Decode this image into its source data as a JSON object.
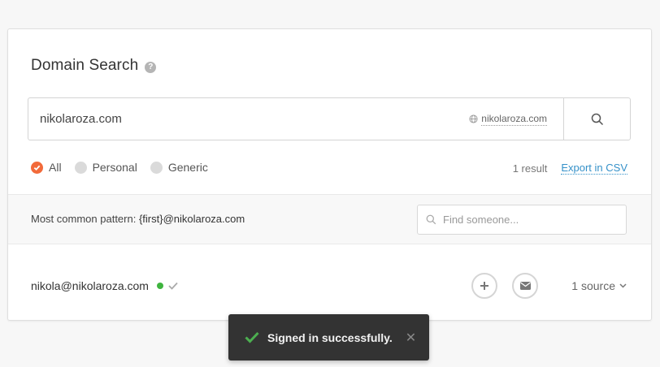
{
  "header": {
    "title": "Domain Search",
    "help_icon": "?"
  },
  "search": {
    "value": "nikolaroza.com",
    "domain_hint": "nikolaroza.com"
  },
  "filters": [
    {
      "label": "All",
      "checked": true
    },
    {
      "label": "Personal",
      "checked": false
    },
    {
      "label": "Generic",
      "checked": false
    }
  ],
  "results": {
    "count_text": "1 result",
    "export_label": "Export in CSV"
  },
  "pattern": {
    "label": "Most common pattern:",
    "value": "{first}@nikolaroza.com"
  },
  "find": {
    "placeholder": "Find someone..."
  },
  "row": {
    "email": "nikola@nikolaroza.com",
    "sources_label": "1 source"
  },
  "toast": {
    "message": "Signed in successfully.",
    "close": "✕"
  },
  "colors": {
    "accent": "#f26a3a",
    "link": "#3591c9",
    "verified": "#3fb43f",
    "toast_check": "#4caf50"
  }
}
